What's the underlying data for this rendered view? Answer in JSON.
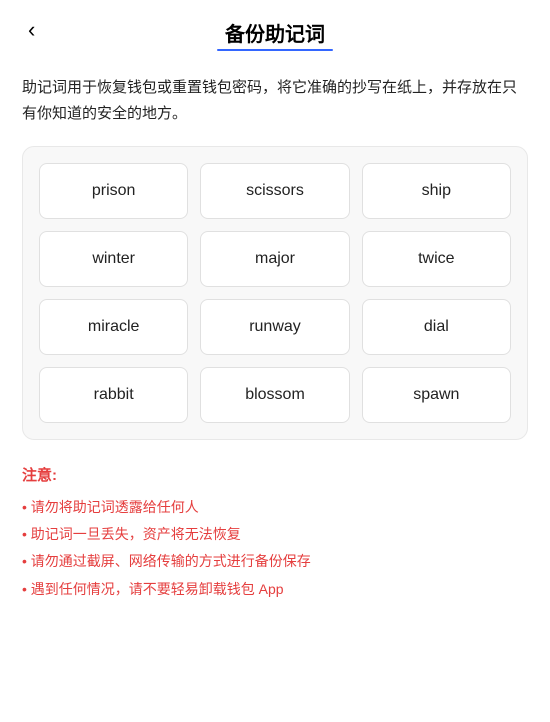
{
  "header": {
    "back_label": "‹",
    "title": "备份助记词",
    "underline_color": "#3366ff"
  },
  "description": {
    "text": "助记词用于恢复钱包或重置钱包密码，将它准确的抄写在纸上，并存放在只有你知道的安全的地方。"
  },
  "mnemonic": {
    "words": [
      "prison",
      "scissors",
      "ship",
      "winter",
      "major",
      "twice",
      "miracle",
      "runway",
      "dial",
      "rabbit",
      "blossom",
      "spawn"
    ]
  },
  "notice": {
    "title": "注意:",
    "items": [
      "请勿将助记词透露给任何人",
      "助记词一旦丢失，资产将无法恢复",
      "请勿通过截屏、网络传输的方式进行备份保存",
      "遇到任何情况，请不要轻易卸载钱包 App"
    ]
  }
}
